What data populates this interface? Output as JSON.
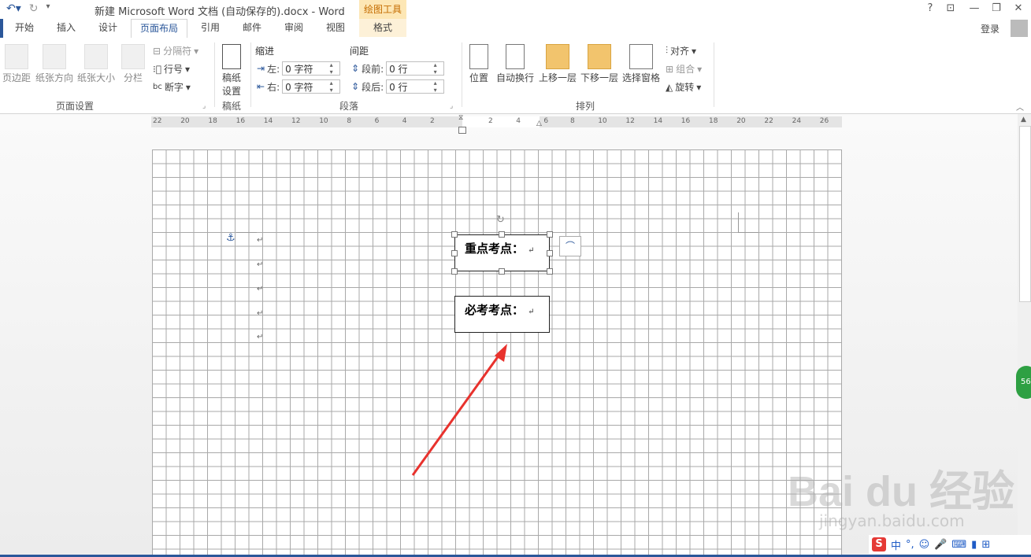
{
  "titlebar": {
    "title": "新建 Microsoft Word 文档 (自动保存的).docx - Word",
    "context_tab": "绘图工具",
    "help": "?",
    "minimize": "—",
    "restore": "❐",
    "close": "✕",
    "ribbon_options": "⊡"
  },
  "tabs": [
    "开始",
    "插入",
    "设计",
    "页面布局",
    "引用",
    "邮件",
    "审阅",
    "视图",
    "格式"
  ],
  "login": "登录",
  "page_setup": {
    "margins": "页边距",
    "orientation": "纸张方向",
    "size": "纸张大小",
    "columns": "分栏",
    "breaks": "分隔符",
    "line_numbers": "行号",
    "hyphenation": "断字",
    "label": "页面设置"
  },
  "manuscript": {
    "btn_line1": "稿纸",
    "btn_line2": "设置",
    "label": "稿纸"
  },
  "paragraph": {
    "indent_title": "缩进",
    "spacing_title": "间距",
    "left_label": "左:",
    "right_label": "右:",
    "before_label": "段前:",
    "after_label": "段后:",
    "left_value": "0 字符",
    "right_value": "0 字符",
    "before_value": "0 行",
    "after_value": "0 行",
    "label": "段落"
  },
  "arrange": {
    "position": "位置",
    "wrap": "自动换行",
    "bring_forward": "上移一层",
    "send_backward": "下移一层",
    "selection_pane": "选择窗格",
    "align": "对齐",
    "group": "组合",
    "rotate": "旋转",
    "label": "排列"
  },
  "ruler": {
    "ticks_left": [
      "22",
      "20",
      "18",
      "16",
      "14",
      "12",
      "10",
      "8",
      "6",
      "4",
      "2"
    ],
    "ticks_mid": [
      "2",
      "4",
      "6"
    ],
    "ticks_right": [
      "8",
      "10",
      "12",
      "14",
      "16",
      "18",
      "20",
      "22",
      "24",
      "26"
    ]
  },
  "document": {
    "textbox1": "重点考点：",
    "textbox2": "必考考点：",
    "para_mark": "↵"
  },
  "side_badge": "56",
  "ime": {
    "logo": "S",
    "lang": "中",
    "punct": "°,"
  },
  "watermark": {
    "brand": "Bai du 经验",
    "url": "jingyan.baidu.com"
  }
}
